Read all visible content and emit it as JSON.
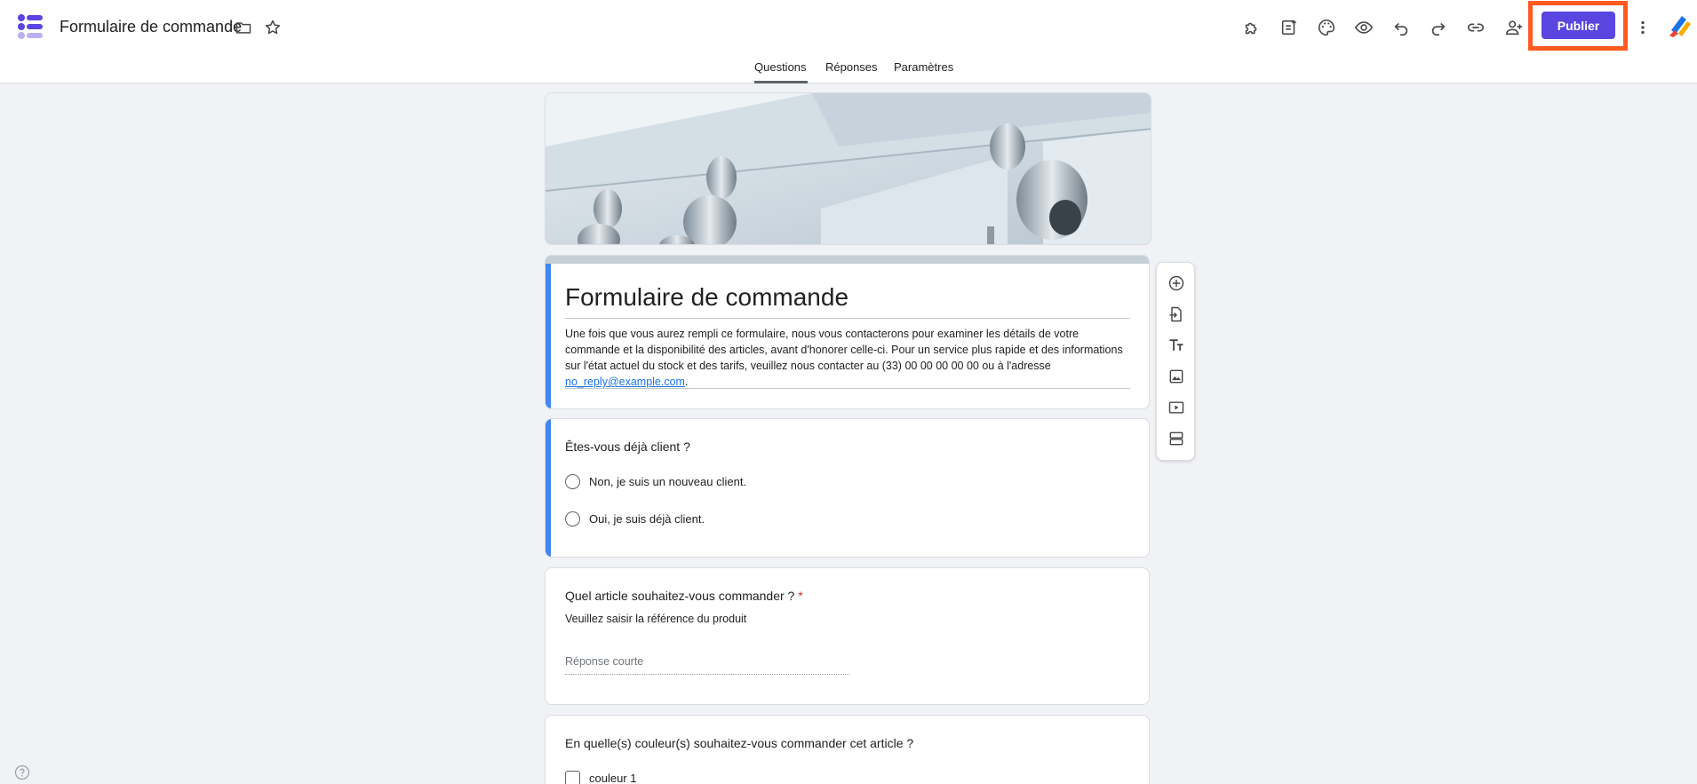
{
  "app": {
    "title": "Formulaire de commande",
    "icons": [
      "forms-logo-icon",
      "folder-icon",
      "star-icon"
    ]
  },
  "toolbar": {
    "icons": [
      "puzzle-addons-icon",
      "customize-question-icon",
      "palette-icon",
      "preview-eye-icon",
      "undo-icon",
      "redo-icon",
      "link-icon",
      "add-collaborator-icon"
    ],
    "publish_label": "Publier",
    "publish_color": "#5b45e0",
    "highlight_color": "#ff5a1f",
    "more_icon": "more-vert-icon",
    "brand_icon": "brand-extension-icon"
  },
  "tabs": [
    {
      "label": "Questions",
      "active": true
    },
    {
      "label": "Réponses",
      "active": false
    },
    {
      "label": "Paramètres",
      "active": false
    }
  ],
  "form": {
    "title": "Formulaire de commande",
    "description_text": "Une fois que vous aurez rempli ce formulaire, nous vous contacterons pour examiner les détails de votre commande et la disponibilité des articles, avant d'honorer celle-ci. Pour un service plus rapide et des informations sur l'état actuel du stock et des tarifs, veuillez nous contacter au (33) 00 00 00 00 00 ou à l'adresse ",
    "description_link": "no_reply@example.com",
    "description_end": "."
  },
  "questions": [
    {
      "title": "Êtes-vous déjà client ?",
      "type": "radio",
      "options": [
        "Non, je suis un nouveau client.",
        "Oui, je suis déjà client."
      ]
    },
    {
      "title": "Quel article souhaitez-vous commander ?",
      "required_mark": "*",
      "subtitle": "Veuillez saisir la référence du produit",
      "type": "short",
      "placeholder": "Réponse courte"
    },
    {
      "title": "En quelle(s) couleur(s) souhaitez-vous commander cet article ?",
      "type": "checkbox",
      "options": [
        "couleur 1"
      ]
    }
  ],
  "side_toolbar": [
    "add-question-icon",
    "import-questions-icon",
    "add-title-icon",
    "add-image-icon",
    "add-video-icon",
    "add-section-icon"
  ],
  "help_icon": "help-icon",
  "accent_color": "#4285f4"
}
